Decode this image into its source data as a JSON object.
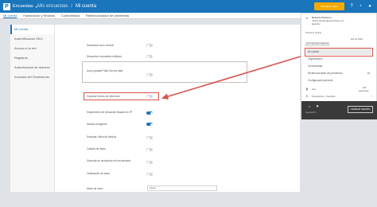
{
  "topbar": {
    "logo_letter": "P",
    "product": "Encuestas",
    "caret": "▾",
    "breadcrumb_parent": "Mis encuestas",
    "breadcrumb_sep": "/",
    "breadcrumb_current": "Mi cuenta",
    "trial_button": "Actualizar ahora",
    "icons": [
      "help-icon",
      "bell-icon",
      "user-icon"
    ]
  },
  "subnav": {
    "tabs": [
      "Mi cuenta",
      "Facturación y Recibos",
      "Conformidad",
      "Redireccionador de problemas"
    ]
  },
  "sidebar": {
    "items": [
      "Mi cuenta",
      "Autentificación SSO",
      "Acceso a la red",
      "Registros",
      "Autenticación de dominio",
      "Industria del Sentimiento"
    ]
  },
  "settings": {
    "rows": [
      {
        "label": "Desactivar suen several",
        "on": false
      },
      {
        "label": "Desactivar encuestas múltiples",
        "on": false
      },
      {
        "label": "Auto poputate Take Survey data",
        "on": false
      },
      {
        "label": "Capturar fechas de obtención",
        "on": false
      },
      {
        "label": "Seguimiento de Ubicación Basado en IP",
        "on": true
      },
      {
        "label": "Mostrar imágenes",
        "on": true
      },
      {
        "label": "Escriptar Ubica de Medios",
        "on": false
      },
      {
        "label": "Calidad de datos",
        "on": false
      },
      {
        "label": "Garantía de anonimato del encuestado",
        "on": false
      },
      {
        "label": "Verificación de edad",
        "on": false
      }
    ],
    "start_label": "Modo de inicio",
    "start_value": "Inicial"
  },
  "dropdown": {
    "user_name": "Roberto Pacheco",
    "user_email": "roberto.pacheco@questionpro.com",
    "user_role": "Ejecutivo",
    "plan_label": "Premium Online",
    "plan_button": "ACTUALIZAR CUENTA",
    "plan_expiry": "Dec 31 2026",
    "items": [
      {
        "label": "Mi cuenta",
        "active": true
      },
      {
        "label": "Organización",
        "active": false
      },
      {
        "label": "Conformidad",
        "active": false
      },
      {
        "label": "Redireccionador de problemas",
        "active": false,
        "count": "16"
      },
      {
        "label": "Configuración general",
        "active": false
      }
    ],
    "usage_label": "Uso",
    "usage_value": "200",
    "usage_unit": "Respuestas",
    "billing_label": "Facturación y Recibos",
    "footer_left": "QuestionPro",
    "logout": "CERRAR SESIÓN"
  },
  "colors": {
    "primary": "#1a75bb",
    "accent": "#f2a900",
    "highlight": "#d9534f"
  }
}
